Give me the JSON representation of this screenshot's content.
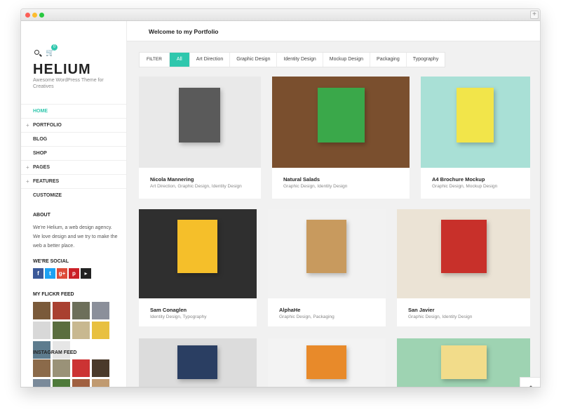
{
  "window": {
    "new_tab_label": "+"
  },
  "sidebar": {
    "cart_count": "0",
    "logo": "HELIUM",
    "tagline": "Awesome WordPress Theme for Creatives",
    "menu": [
      {
        "label": "HOME",
        "active": true,
        "has_sub": false
      },
      {
        "label": "PORTFOLIO",
        "active": false,
        "has_sub": true
      },
      {
        "label": "BLOG",
        "active": false,
        "has_sub": false
      },
      {
        "label": "SHOP",
        "active": false,
        "has_sub": false
      },
      {
        "label": "PAGES",
        "active": false,
        "has_sub": true
      },
      {
        "label": "FEATURES",
        "active": false,
        "has_sub": true
      },
      {
        "label": "CUSTOMIZE",
        "active": false,
        "has_sub": false
      }
    ],
    "about_heading": "ABOUT",
    "about_text": "We're Helium, a web design agency. We love design and we try to make the web a better place.",
    "social_heading": "WE'RE SOCIAL",
    "social": [
      {
        "icon": "facebook-icon",
        "glyph": "f",
        "color": "#3b5998"
      },
      {
        "icon": "twitter-icon",
        "glyph": "t",
        "color": "#1da1f2"
      },
      {
        "icon": "google-plus-icon",
        "glyph": "g+",
        "color": "#dd4b39"
      },
      {
        "icon": "pinterest-icon",
        "glyph": "p",
        "color": "#cb2027"
      },
      {
        "icon": "rss-icon",
        "glyph": "▸",
        "color": "#222222"
      }
    ],
    "flickr_heading": "MY FLICKR FEED",
    "flickr_colors": [
      "#7a5a3a",
      "#a94030",
      "#6d6f5a",
      "#8b8f9a",
      "#d8d8d8",
      "#5a6e3e",
      "#c8b890",
      "#e8c040",
      "#5e7c8e",
      "#e6e6e6"
    ],
    "instagram_heading": "INSTAGRAM FEED",
    "instagram_colors": [
      "#8b6a4a",
      "#9a9278",
      "#cc3333",
      "#4a3a2a",
      "#7a8a9a",
      "#4e7a3a",
      "#a06040",
      "#c09a70"
    ]
  },
  "main": {
    "title": "Welcome to my Portfolio",
    "filter_label": "FILTER",
    "filters": [
      {
        "label": "All",
        "active": true
      },
      {
        "label": "Art Direction",
        "active": false
      },
      {
        "label": "Graphic Design",
        "active": false
      },
      {
        "label": "Identity Design",
        "active": false
      },
      {
        "label": "Mockup Design",
        "active": false
      },
      {
        "label": "Packaging",
        "active": false
      },
      {
        "label": "Typography",
        "active": false
      }
    ],
    "items": [
      {
        "title": "Nicola Mannering",
        "cats": "Art Direction, Graphic Design, Identity Design",
        "bg": "#e9e9e9",
        "accent": "#5a5a5a"
      },
      {
        "title": "Natural Salads",
        "cats": "Graphic Design, Identity Design",
        "bg": "#7a4f2e",
        "accent": "#3aa84a"
      },
      {
        "title": "A4 Brochure Mockup",
        "cats": "Graphic Design, Mockup Design",
        "bg": "#a9e0d6",
        "accent": "#f2e54a"
      },
      {
        "title": "Sam Conaglen",
        "cats": "Identity Design, Typography",
        "bg": "#2f2f2f",
        "accent": "#f5bf2a"
      },
      {
        "title": "AlphaHe",
        "cats": "Graphic Design, Packaging",
        "bg": "#f2f2f2",
        "accent": "#c89a5e"
      },
      {
        "title": "San Javier",
        "cats": "Graphic Design, Identity Design",
        "bg": "#ebe3d5",
        "accent": "#c8302a"
      },
      {
        "title": "",
        "cats": "",
        "bg": "#dcdcdc",
        "accent": "#2a3e62"
      },
      {
        "title": "",
        "cats": "",
        "bg": "#f3f3f3",
        "accent": "#e88a2a"
      },
      {
        "title": "",
        "cats": "",
        "bg": "#9ed3b2",
        "accent": "#f2dc8a"
      }
    ],
    "to_top_label": "⌃"
  }
}
